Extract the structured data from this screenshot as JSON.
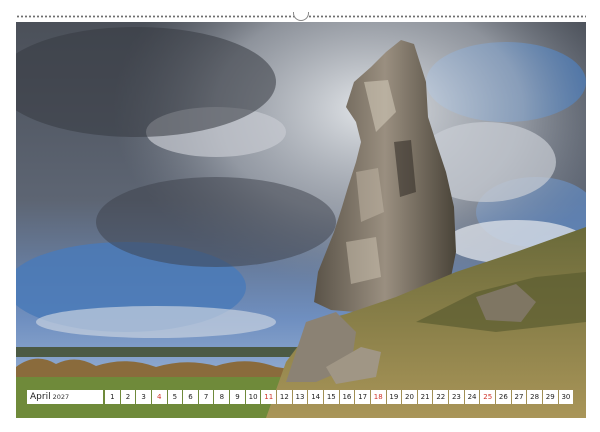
{
  "calendar": {
    "month": "April",
    "year": "2027",
    "days": [
      "1",
      "2",
      "3",
      "4",
      "5",
      "6",
      "7",
      "8",
      "9",
      "10",
      "11",
      "12",
      "13",
      "14",
      "15",
      "16",
      "17",
      "18",
      "19",
      "20",
      "21",
      "22",
      "23",
      "24",
      "25",
      "26",
      "27",
      "28",
      "29",
      "30"
    ],
    "sundays": [
      "4",
      "11",
      "18",
      "25"
    ]
  },
  "colors": {
    "sky_blue": "#3d6fae",
    "storm_cloud": "#3a3f48",
    "rock": "#7d7468",
    "grass": "#6f8a3a",
    "sunday_red": "#d0342c"
  }
}
